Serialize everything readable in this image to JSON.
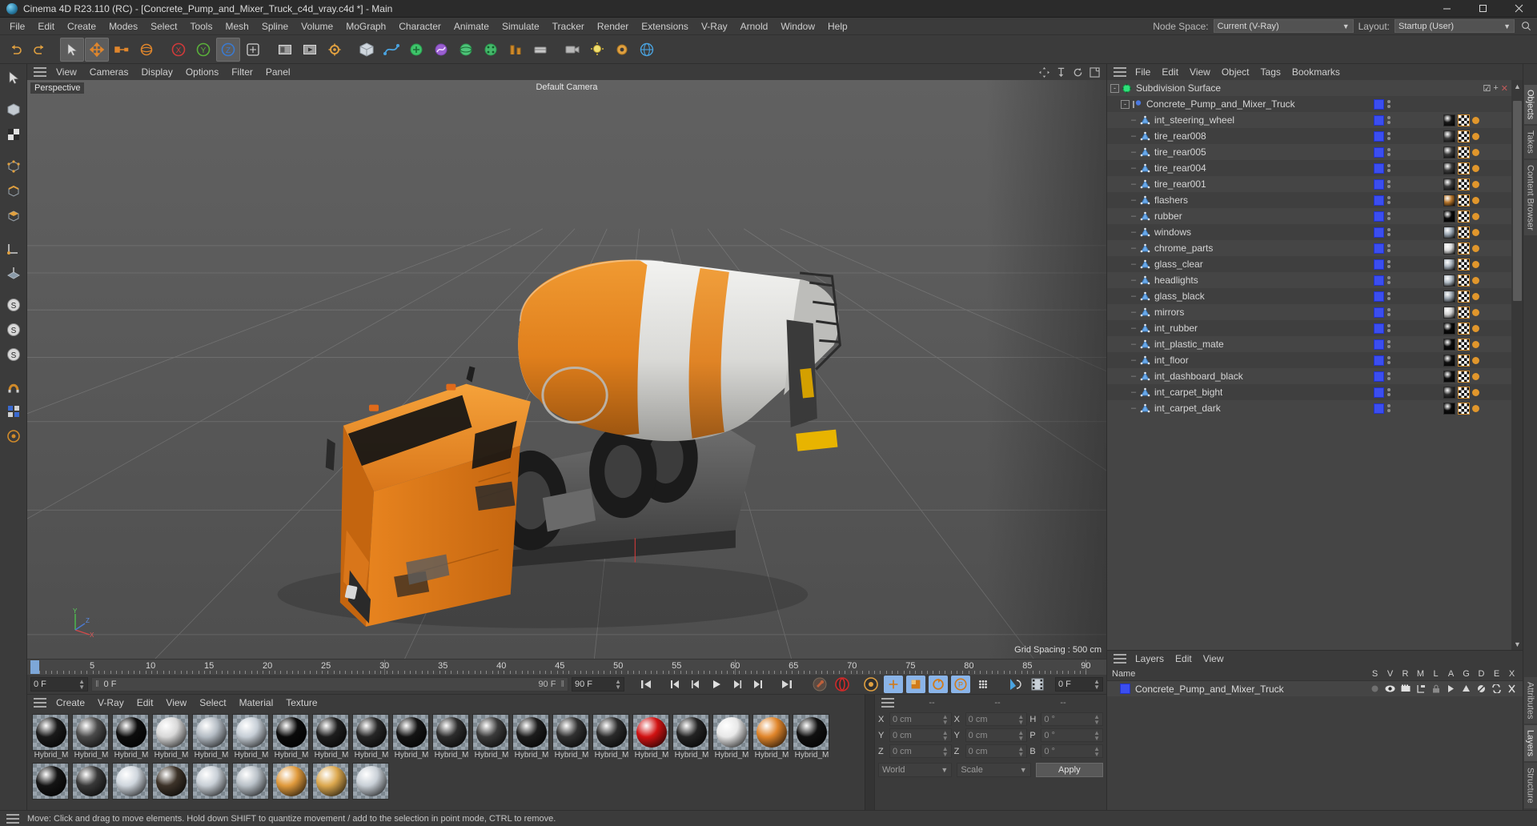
{
  "window": {
    "title": "Cinema 4D R23.110 (RC) - [Concrete_Pump_and_Mixer_Truck_c4d_vray.c4d *] - Main",
    "app_icon": "c4d-logo-icon",
    "minimize": "–",
    "maximize": "❐",
    "close": "✕"
  },
  "menubar": {
    "items": [
      "File",
      "Edit",
      "Create",
      "Modes",
      "Select",
      "Tools",
      "Mesh",
      "Spline",
      "Volume",
      "MoGraph",
      "Character",
      "Animate",
      "Simulate",
      "Tracker",
      "Render",
      "Extensions",
      "V-Ray",
      "Arnold",
      "Window",
      "Help"
    ],
    "node_space_label": "Node Space:",
    "node_space_value": "Current (V-Ray)",
    "layout_label": "Layout:",
    "layout_value": "Startup (User)",
    "search_icon": "search-icon"
  },
  "toolbar": {
    "buttons": [
      {
        "name": "undo-button",
        "icon": "undo-arrow",
        "active": false
      },
      {
        "name": "redo-button",
        "icon": "redo-arrow",
        "active": false
      },
      {
        "name": "live-selection-tool",
        "icon": "cursor-arrow",
        "active": true
      },
      {
        "name": "move-tool",
        "icon": "move-cross",
        "active": true
      },
      {
        "name": "scale-tool",
        "icon": "scale-square",
        "active": false
      },
      {
        "name": "rotate-tool",
        "icon": "rotate-circle",
        "active": false
      },
      {
        "name": "lock-x-axis",
        "icon": "axis-x",
        "active": false
      },
      {
        "name": "lock-y-axis",
        "icon": "axis-y",
        "active": false
      },
      {
        "name": "lock-z-axis",
        "icon": "axis-z",
        "active": false
      },
      {
        "name": "world-object-coordinate",
        "icon": "world-axis",
        "active": false
      },
      {
        "name": "render-view",
        "icon": "render-frame",
        "active": false
      },
      {
        "name": "render-to-picture-viewer",
        "icon": "render-play",
        "active": false
      },
      {
        "name": "render-settings",
        "icon": "render-gear",
        "active": false
      },
      {
        "name": "add-cube",
        "icon": "cube",
        "active": false
      },
      {
        "name": "add-spline",
        "icon": "spline-pen",
        "active": false
      },
      {
        "name": "add-generator",
        "icon": "generator-green",
        "active": false
      },
      {
        "name": "add-deformer",
        "icon": "deformer-purple",
        "active": false
      },
      {
        "name": "add-environment",
        "icon": "environment-green",
        "active": false
      },
      {
        "name": "add-camera",
        "icon": "camera",
        "active": false
      },
      {
        "name": "add-light",
        "icon": "light-bulb",
        "active": false
      },
      {
        "name": "add-mograph",
        "icon": "mograph-grid",
        "active": false
      },
      {
        "name": "add-deformer-2",
        "icon": "deformer-bend",
        "active": false
      },
      {
        "name": "simulate-tag",
        "icon": "simulate-tag",
        "active": false
      },
      {
        "name": "motion-tracker",
        "icon": "tracker-gear",
        "active": false
      },
      {
        "name": "web-help",
        "icon": "globe",
        "active": false
      }
    ]
  },
  "left_rail": {
    "buttons": [
      {
        "name": "live-selection-tool",
        "icon": "cursor-arrow"
      },
      {
        "name": "model-mode",
        "icon": "model-cube"
      },
      {
        "name": "texture-mode",
        "icon": "texture-checker"
      },
      {
        "name": "points-mode",
        "icon": "points-cube"
      },
      {
        "name": "edges-mode",
        "icon": "edges-cube"
      },
      {
        "name": "polygons-mode",
        "icon": "polygons-cube"
      },
      {
        "name": "enable-axis-mode",
        "icon": "axis-mode"
      },
      {
        "name": "enable-snap",
        "icon": "snap-magnet"
      },
      {
        "name": "workplane-mode",
        "icon": "workplane"
      },
      {
        "name": "viewport-solo-single",
        "icon": "solo-s1"
      },
      {
        "name": "viewport-solo-hierarchy",
        "icon": "solo-s2"
      },
      {
        "name": "viewport-solo-off",
        "icon": "solo-s3"
      },
      {
        "name": "snap-settings",
        "icon": "snap-settings"
      },
      {
        "name": "quantize-settings",
        "icon": "quantize"
      },
      {
        "name": "workplane-lock",
        "icon": "workplane-lock"
      },
      {
        "name": "polygon-pen",
        "icon": "poly-pen"
      }
    ]
  },
  "viewport": {
    "menu_items": [
      "View",
      "Cameras",
      "Display",
      "Options",
      "Filter",
      "Panel"
    ],
    "perspective_label": "Perspective",
    "camera_label": "Default Camera",
    "grid_spacing": "Grid Spacing : 500 cm",
    "corner_icons": [
      "move-view-icon",
      "zoom-view-icon",
      "rotate-view-icon",
      "maximize-view-icon"
    ],
    "axis_labels": {
      "x": "X",
      "y": "Y",
      "z": "Z"
    },
    "model_description": "Orange concrete mixer truck 3D model in perspective viewport"
  },
  "timeline": {
    "tick_labels": [
      "0",
      "5",
      "10",
      "15",
      "20",
      "25",
      "30",
      "35",
      "40",
      "45",
      "50",
      "55",
      "60",
      "65",
      "70",
      "75",
      "80",
      "85",
      "90"
    ],
    "range_start": 0,
    "range_end": 90,
    "current_frame_field": "0 F",
    "current_frame_track": "0 F",
    "end_field_left": "90 F",
    "end_field_right": "90 F",
    "preview_end_field": "0 F",
    "transport": [
      {
        "name": "go-to-start-button",
        "icon": "skip-start"
      },
      {
        "name": "go-to-previous-keyframe-button",
        "icon": "prev-key"
      },
      {
        "name": "step-back-button",
        "icon": "step-back"
      },
      {
        "name": "play-button",
        "icon": "play"
      },
      {
        "name": "step-forward-button",
        "icon": "step-forward"
      },
      {
        "name": "go-to-next-keyframe-button",
        "icon": "next-key"
      },
      {
        "name": "go-to-end-button",
        "icon": "skip-end"
      }
    ],
    "record_tools": [
      {
        "name": "record-active-objects-button",
        "icon": "key-record"
      },
      {
        "name": "autokeying-button",
        "icon": "autokey-red"
      },
      {
        "name": "keyframe-selection-button",
        "icon": "key-gear"
      },
      {
        "name": "position-key-toggle",
        "icon": "key-position",
        "on": true
      },
      {
        "name": "scale-key-toggle",
        "icon": "key-scale",
        "on": true
      },
      {
        "name": "rotation-key-toggle",
        "icon": "key-rotation",
        "on": true
      },
      {
        "name": "parameter-key-toggle",
        "icon": "key-parameter",
        "on": true
      },
      {
        "name": "point-level-animation-toggle",
        "icon": "key-pla",
        "on": false
      }
    ],
    "right_tools": [
      {
        "name": "motion-system-button",
        "icon": "motion-clip"
      },
      {
        "name": "timeline-button",
        "icon": "film-strip"
      }
    ]
  },
  "material_manager": {
    "menu_items": [
      "Create",
      "V-Ray",
      "Edit",
      "View",
      "Select",
      "Material",
      "Texture"
    ],
    "materials_row1": [
      {
        "label": "Hybrid_M",
        "swatch": "#1a1a1a"
      },
      {
        "label": "Hybrid_M",
        "swatch": "#4a4a4a"
      },
      {
        "label": "Hybrid_M",
        "swatch": "#0d0d0d"
      },
      {
        "label": "Hybrid_M",
        "swatch": "#d8d8d8"
      },
      {
        "label": "Hybrid_M",
        "swatch": "#b4bcc4"
      },
      {
        "label": "Hybrid_M",
        "swatch": "#c6ced6"
      },
      {
        "label": "Hybrid_M",
        "swatch": "#0a0a0a"
      },
      {
        "label": "Hybrid_M",
        "swatch": "#1e1e1e"
      },
      {
        "label": "Hybrid_M",
        "swatch": "#262626"
      },
      {
        "label": "Hybrid_M",
        "swatch": "#141414"
      },
      {
        "label": "Hybrid_M",
        "swatch": "#2c2c2c"
      },
      {
        "label": "Hybrid_M",
        "swatch": "#3a3a3a"
      },
      {
        "label": "Hybrid_M",
        "swatch": "#1c1c1c"
      },
      {
        "label": "Hybrid_M",
        "swatch": "#303030"
      },
      {
        "label": "Hybrid_M",
        "swatch": "#2a2a2a"
      },
      {
        "label": "Hybrid_M",
        "swatch": "#d11212"
      },
      {
        "label": "Hybrid_M",
        "swatch": "#232323"
      },
      {
        "label": "Hybrid_M",
        "swatch": "#e8e8e8"
      },
      {
        "label": "Hybrid_M",
        "swatch": "#e0852a"
      },
      {
        "label": "Hybrid_M",
        "swatch": "#101010"
      }
    ],
    "materials_row2": [
      {
        "label": "",
        "swatch": "#141414"
      },
      {
        "label": "",
        "swatch": "#383838"
      },
      {
        "label": "",
        "swatch": "#cfd6dd"
      },
      {
        "label": "",
        "swatch": "#3c3228"
      },
      {
        "label": "",
        "swatch": "#c8cfd6"
      },
      {
        "label": "",
        "swatch": "#b9c1c8"
      },
      {
        "label": "",
        "swatch": "#e09a3c"
      },
      {
        "label": "",
        "swatch": "#dca84e"
      },
      {
        "label": "",
        "swatch": "#c9d0d7"
      }
    ]
  },
  "coordinates": {
    "headers": [
      "--",
      "--",
      "--"
    ],
    "rows": [
      {
        "axis1": "X",
        "val1": "0 cm",
        "axis2": "X",
        "val2": "0 cm",
        "axis3": "H",
        "val3": "0 °"
      },
      {
        "axis1": "Y",
        "val1": "0 cm",
        "axis2": "Y",
        "val2": "0 cm",
        "axis3": "P",
        "val3": "0 °"
      },
      {
        "axis1": "Z",
        "val1": "0 cm",
        "axis2": "Z",
        "val2": "0 cm",
        "axis3": "B",
        "val3": "0 °"
      }
    ],
    "space_select": "World",
    "mode_select": "Scale",
    "apply_button": "Apply"
  },
  "object_manager": {
    "menu_items": [
      "File",
      "Edit",
      "View",
      "Object",
      "Tags",
      "Bookmarks"
    ],
    "rows": [
      {
        "name": "Subdivision Surface",
        "depth": 0,
        "icon": "subdivision-surface-icon",
        "expander": "-",
        "has_tags": false,
        "header_controls": true
      },
      {
        "name": "Concrete_Pump_and_Mixer_Truck",
        "depth": 1,
        "icon": "null-object-icon",
        "expander": "-",
        "has_tags": false
      },
      {
        "name": "int_steering_wheel",
        "depth": 2,
        "icon": "polygon-object-icon",
        "has_tags": true,
        "swatch": "#181818"
      },
      {
        "name": "tire_rear008",
        "depth": 2,
        "icon": "polygon-object-icon",
        "has_tags": true,
        "swatch": "#3c3c3c"
      },
      {
        "name": "tire_rear005",
        "depth": 2,
        "icon": "polygon-object-icon",
        "has_tags": true,
        "swatch": "#3c3c3c"
      },
      {
        "name": "tire_rear004",
        "depth": 2,
        "icon": "polygon-object-icon",
        "has_tags": true,
        "swatch": "#3c3c3c"
      },
      {
        "name": "tire_rear001",
        "depth": 2,
        "icon": "polygon-object-icon",
        "has_tags": true,
        "swatch": "#3c3c3c"
      },
      {
        "name": "flashers",
        "depth": 2,
        "icon": "polygon-object-icon",
        "has_tags": true,
        "swatch": "#b5742a"
      },
      {
        "name": "rubber",
        "depth": 2,
        "icon": "polygon-object-icon",
        "has_tags": true,
        "swatch": "#0a0a0a"
      },
      {
        "name": "windows",
        "depth": 2,
        "icon": "polygon-object-icon",
        "has_tags": true,
        "swatch": "#9aa6b2"
      },
      {
        "name": "chrome_parts",
        "depth": 2,
        "icon": "polygon-object-icon",
        "has_tags": true,
        "swatch": "#d9d9d9"
      },
      {
        "name": "glass_clear",
        "depth": 2,
        "icon": "polygon-object-icon",
        "has_tags": true,
        "swatch": "#a8b2bc"
      },
      {
        "name": "headlights",
        "depth": 2,
        "icon": "polygon-object-icon",
        "has_tags": true,
        "swatch": "#b0bac4"
      },
      {
        "name": "glass_black",
        "depth": 2,
        "icon": "polygon-object-icon",
        "has_tags": true,
        "swatch": "#9ba5af"
      },
      {
        "name": "mirrors",
        "depth": 2,
        "icon": "polygon-object-icon",
        "has_tags": true,
        "swatch": "#d0d0d0"
      },
      {
        "name": "int_rubber",
        "depth": 2,
        "icon": "polygon-object-icon",
        "has_tags": true,
        "swatch": "#0a0a0a"
      },
      {
        "name": "int_plastic_mate",
        "depth": 2,
        "icon": "polygon-object-icon",
        "has_tags": true,
        "swatch": "#0d0d0d"
      },
      {
        "name": "int_floor",
        "depth": 2,
        "icon": "polygon-object-icon",
        "has_tags": true,
        "swatch": "#111111"
      },
      {
        "name": "int_dashboard_black",
        "depth": 2,
        "icon": "polygon-object-icon",
        "has_tags": true,
        "swatch": "#0f0f0f"
      },
      {
        "name": "int_carpet_bight",
        "depth": 2,
        "icon": "polygon-object-icon",
        "has_tags": true,
        "swatch": "#2e2e2e"
      },
      {
        "name": "int_carpet_dark",
        "depth": 2,
        "icon": "polygon-object-icon",
        "has_tags": true,
        "swatch": "#0c0c0c"
      }
    ],
    "top_row_controls": {
      "checkbox": "☑",
      "plus": "+",
      "close": "✕"
    }
  },
  "layers_manager": {
    "menu_items": [
      "Layers",
      "Edit",
      "View"
    ],
    "name_header": "Name",
    "columns": [
      "S",
      "V",
      "R",
      "M",
      "L",
      "A",
      "G",
      "D",
      "E",
      "X"
    ],
    "rows": [
      {
        "name": "Concrete_Pump_and_Mixer_Truck",
        "swatch": "#3b4ef0"
      }
    ]
  },
  "edge_tabs": {
    "top": [
      "Objects",
      "Takes",
      "Content Browser"
    ],
    "bottom": [
      "Attributes",
      "Layers",
      "Structure"
    ],
    "selected_top": "Objects",
    "selected_bottom": "Layers"
  },
  "statusbar": {
    "text": "Move: Click and drag to move elements. Hold down SHIFT to quantize movement / add to the selection in point mode, CTRL to remove."
  },
  "colors": {
    "accent_blue": "#3b4ef0",
    "highlight_blue": "#8ab4e8",
    "orange": "#e0862c",
    "panel_bg": "#3b3b3b",
    "list_bg": "#454545",
    "titlebar_bg": "#2b2b2b"
  }
}
